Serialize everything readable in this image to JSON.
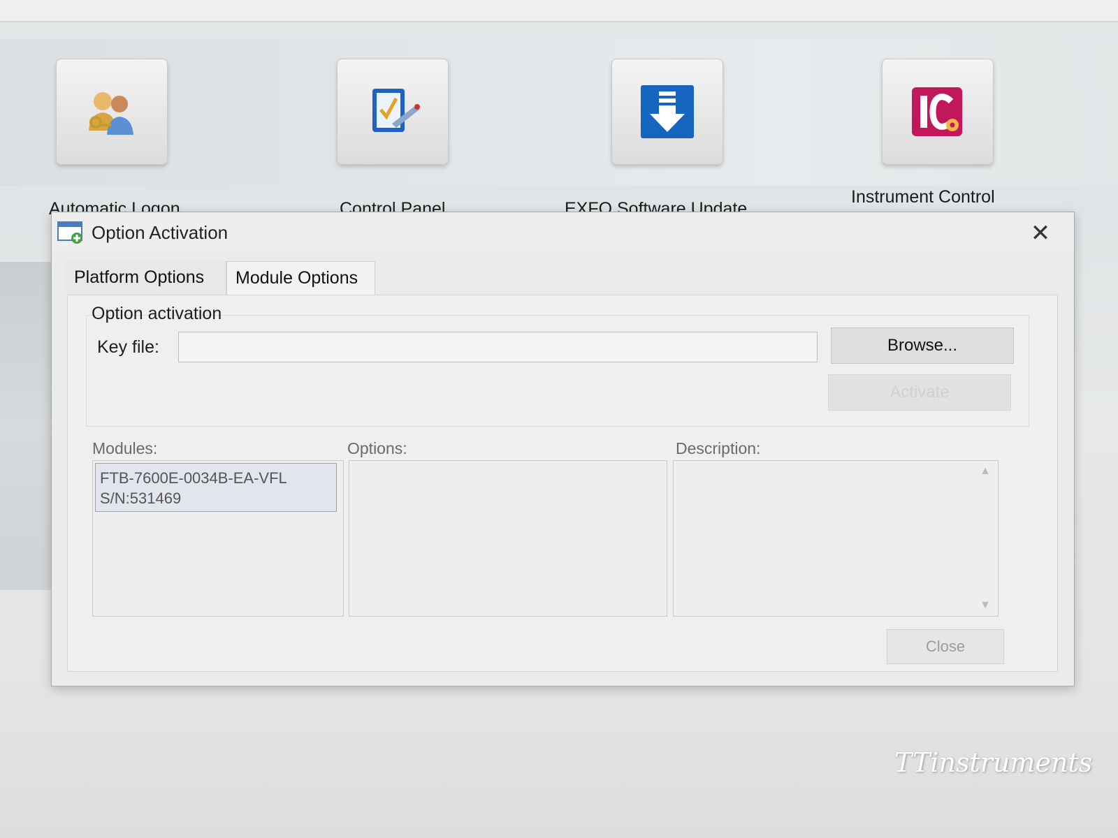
{
  "launcher": {
    "items": [
      {
        "label": "Automatic Logon",
        "icon": "users-key-icon"
      },
      {
        "label": "Control Panel",
        "icon": "checklist-pen-icon"
      },
      {
        "label": "EXFO Software Update",
        "icon": "download-arrow-icon"
      },
      {
        "label": "Instrument Control",
        "icon": "ic-gear-icon"
      }
    ]
  },
  "dialog": {
    "title": "Option Activation",
    "close_glyph": "✕",
    "tabs": [
      {
        "label": "Platform Options",
        "active": false
      },
      {
        "label": "Module Options",
        "active": true
      }
    ],
    "activation": {
      "group_label": "Option activation",
      "key_file_label": "Key file:",
      "key_file_value": "",
      "browse_label": "Browse...",
      "activate_label": "Activate"
    },
    "modules": {
      "label": "Modules:",
      "items": [
        {
          "line1": "FTB-7600E-0034B-EA-VFL",
          "line2": "S/N:531469"
        }
      ]
    },
    "options": {
      "label": "Options:"
    },
    "description": {
      "label": "Description:"
    },
    "close_label": "Close"
  },
  "watermark": "TTinstruments",
  "colors": {
    "accent_blue": "#1565c0",
    "ic_pink": "#c2185b",
    "dialog_bg": "#ebebeb"
  }
}
